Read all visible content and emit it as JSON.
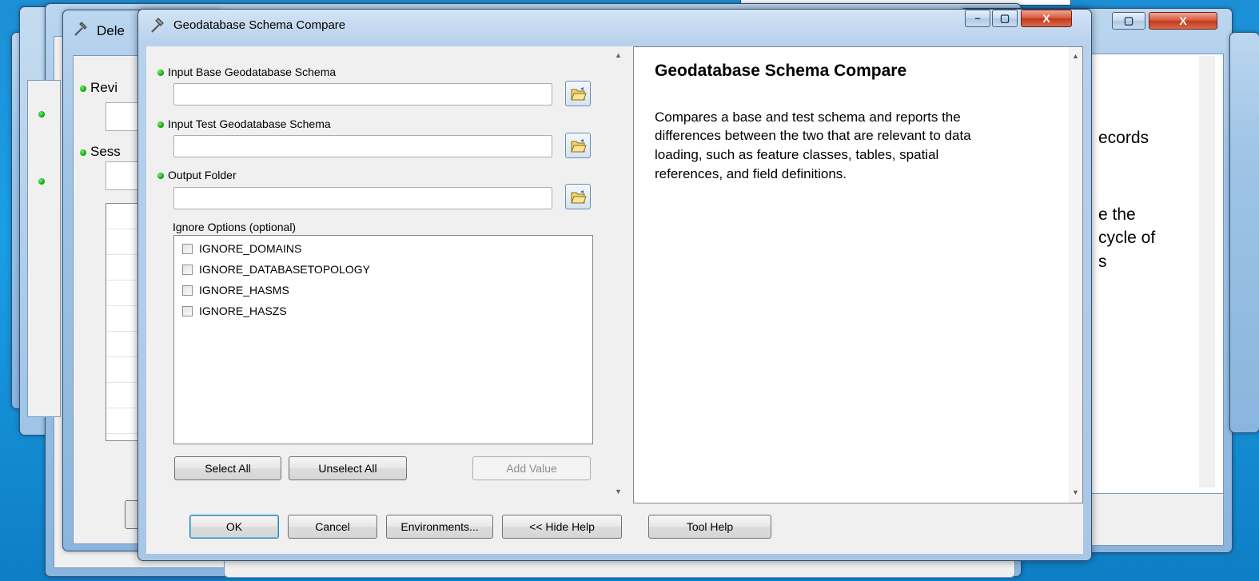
{
  "desktop_colors": {
    "background": "#1a9ee6",
    "dialog_frame": "#a8c6e6"
  },
  "background_windows": {
    "back_dialog_title": "Dele",
    "back_labels": [
      "Revi",
      "Sess"
    ],
    "right_help_fragments": [
      "ecords",
      "e the",
      "cycle of",
      "s"
    ]
  },
  "dialog": {
    "title": "Geodatabase Schema Compare",
    "fields": [
      {
        "label": "Input Base Geodatabase Schema",
        "value": "",
        "required": true
      },
      {
        "label": "Input Test Geodatabase Schema",
        "value": "",
        "required": true
      },
      {
        "label": "Output Folder",
        "value": "",
        "required": true
      }
    ],
    "ignore_options": {
      "label": "Ignore Options (optional)",
      "items": [
        {
          "label": "IGNORE_DOMAINS",
          "checked": false
        },
        {
          "label": "IGNORE_DATABASETOPOLOGY",
          "checked": false
        },
        {
          "label": "IGNORE_HASMS",
          "checked": false
        },
        {
          "label": "IGNORE_HASZS",
          "checked": false
        }
      ],
      "select_all": "Select All",
      "unselect_all": "Unselect All",
      "add_value": "Add Value"
    },
    "help": {
      "title": "Geodatabase Schema Compare",
      "lines": [
        "Compares a base and test schema and reports the",
        "differences between the two that are relevant to data",
        "loading, such as feature classes, tables, spatial",
        "references, and field definitions."
      ]
    },
    "buttons": {
      "ok": "OK",
      "cancel": "Cancel",
      "environments": "Environments...",
      "hide_help": "<< Hide Help",
      "tool_help": "Tool Help"
    }
  }
}
